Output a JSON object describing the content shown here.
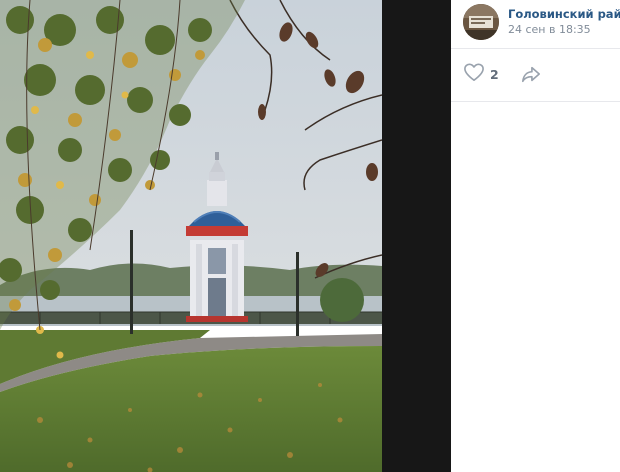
{
  "post": {
    "author": "Головинский район",
    "date": "24 сен в 18:35",
    "likes": "2"
  },
  "icons": {
    "like": "heart-outline-icon",
    "share": "share-arrow-icon"
  },
  "colors": {
    "link": "#2a5885",
    "muted": "#818c99",
    "divider": "#e7e8ec",
    "viewer_strip": "#171717"
  }
}
